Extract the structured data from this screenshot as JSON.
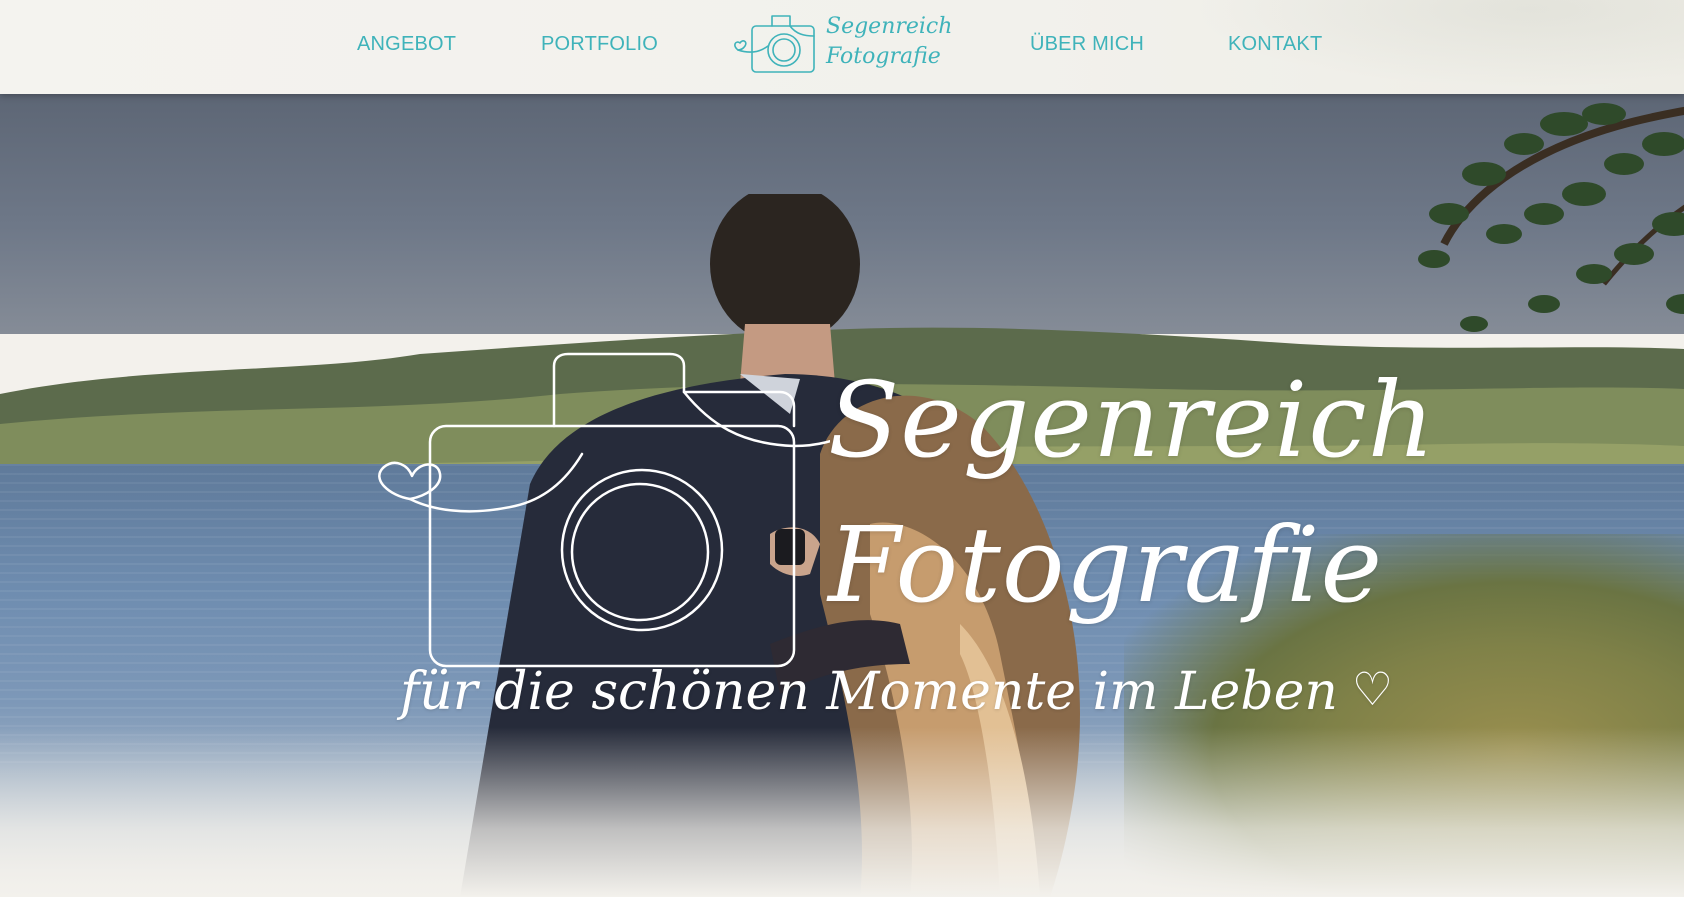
{
  "nav": {
    "items": [
      {
        "label": "ANGEBOT"
      },
      {
        "label": "PORTFOLIO"
      },
      {
        "label": "ÜBER MICH"
      },
      {
        "label": "KONTAKT"
      }
    ],
    "logo": {
      "line1": "Segenreich",
      "line2": "Fotografie",
      "icon": "camera-heart-icon"
    }
  },
  "hero": {
    "title_line1": "Segenreich",
    "title_line2": "Fotografie",
    "tagline": "für die schönen Momente im Leben",
    "tagline_icon": "♡",
    "logo_icon": "camera-heart-icon"
  },
  "colors": {
    "accent": "#3fb3ba",
    "nav_background": "#f3f1ec",
    "hero_text": "#ffffff"
  }
}
